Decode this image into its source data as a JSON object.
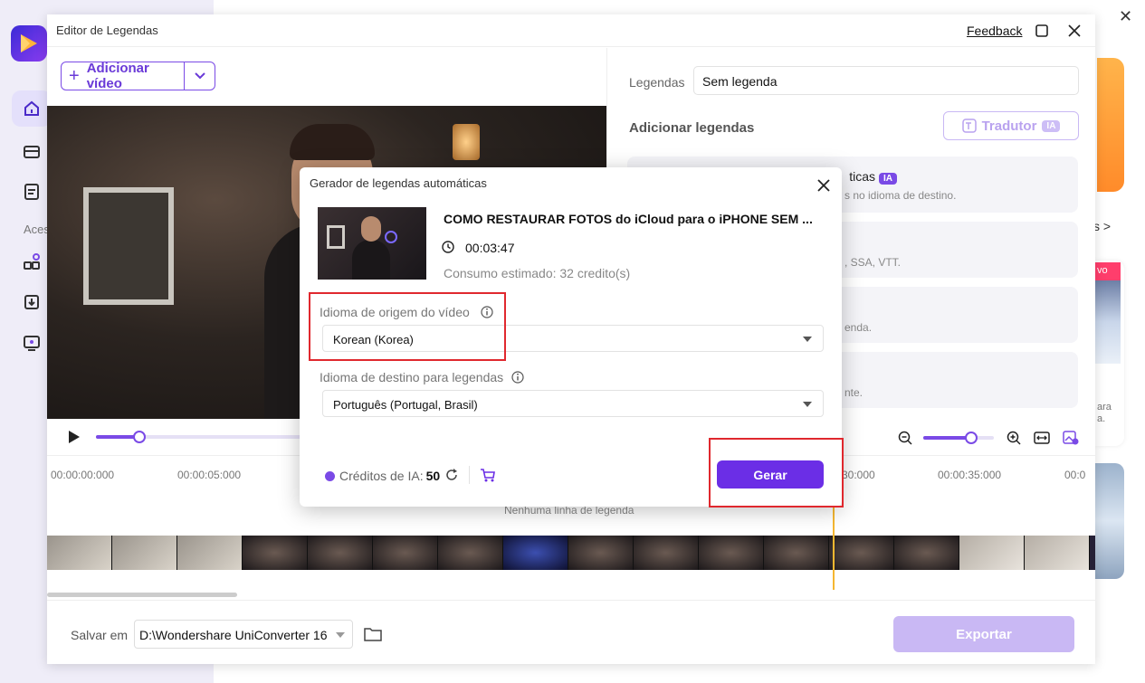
{
  "app": {
    "side_label": "Aces",
    "promo_link": "s >",
    "promo_ribbon": "vo",
    "promo_text": "ara\na."
  },
  "editor": {
    "title": "Editor de Legendas",
    "feedback": "Feedback",
    "add_video": "Adicionar vídeo",
    "progress_percent": 20,
    "zoom_percent": 68,
    "timeline": {
      "ticks": [
        "00:00:00:000",
        "00:00:05:000",
        "30:000",
        "00:00:35:000",
        "00:0"
      ],
      "empty_text": "Nenhuma linha de legenda"
    },
    "bottom": {
      "save_label": "Salvar em",
      "save_path": "D:\\Wondershare UniConverter 16",
      "export": "Exportar"
    },
    "right_panel": {
      "subtitles_label": "Legendas",
      "subtitles_value": "Sem legenda",
      "add_subtitles": "Adicionar legendas",
      "translator": "Tradutor",
      "translator_badge": "IA",
      "cards": [
        {
          "title": "ticas",
          "badge": "IA",
          "sub": "s no idioma de destino."
        },
        {
          "title": "",
          "badge": "",
          "sub": ", SSA, VTT."
        },
        {
          "title": "",
          "badge": "",
          "sub": "enda."
        },
        {
          "title": "",
          "badge": "",
          "sub": "nte."
        }
      ]
    }
  },
  "modal": {
    "title": "Gerador de legendas automáticas",
    "video_title": "COMO RESTAURAR FOTOS do iCloud para o iPHONE SEM ...",
    "duration": "00:03:47",
    "consumption": "Consumo estimado: 32 credito(s)",
    "source_label": "Idioma de origem do vídeo",
    "source_value": "Korean (Korea)",
    "target_label": "Idioma de destino para legendas",
    "target_value": "Português (Portugal, Brasil)",
    "credits_label": "Créditos de IA:",
    "credits_value": "50",
    "generate": "Gerar"
  },
  "colors": {
    "accent": "#6b2ee6",
    "highlight": "#e0282e",
    "playhead": "#f5b731"
  }
}
